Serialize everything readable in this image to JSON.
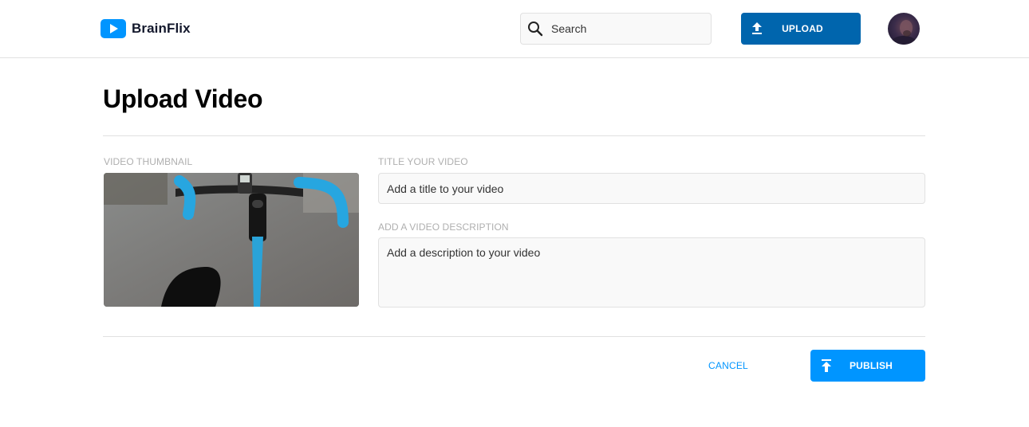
{
  "header": {
    "brand": "BrainFlix",
    "search_placeholder": "Search",
    "upload_label": "UPLOAD"
  },
  "main": {
    "page_title": "Upload Video",
    "thumbnail_label": "VIDEO THUMBNAIL",
    "title_label": "TITLE YOUR VIDEO",
    "title_placeholder": "Add a title to your video",
    "description_label": "ADD A VIDEO DESCRIPTION",
    "description_placeholder": "Add a description to your video"
  },
  "actions": {
    "cancel_label": "CANCEL",
    "publish_label": "PUBLISH"
  },
  "colors": {
    "brand_blue": "#0095ff",
    "upload_button": "#0065ad",
    "divider": "#e1e1e1",
    "label_grey": "#afafaf"
  },
  "icons": {
    "logo": "play-logo-icon",
    "search": "search-icon",
    "upload": "upload-icon",
    "publish": "publish-icon"
  }
}
